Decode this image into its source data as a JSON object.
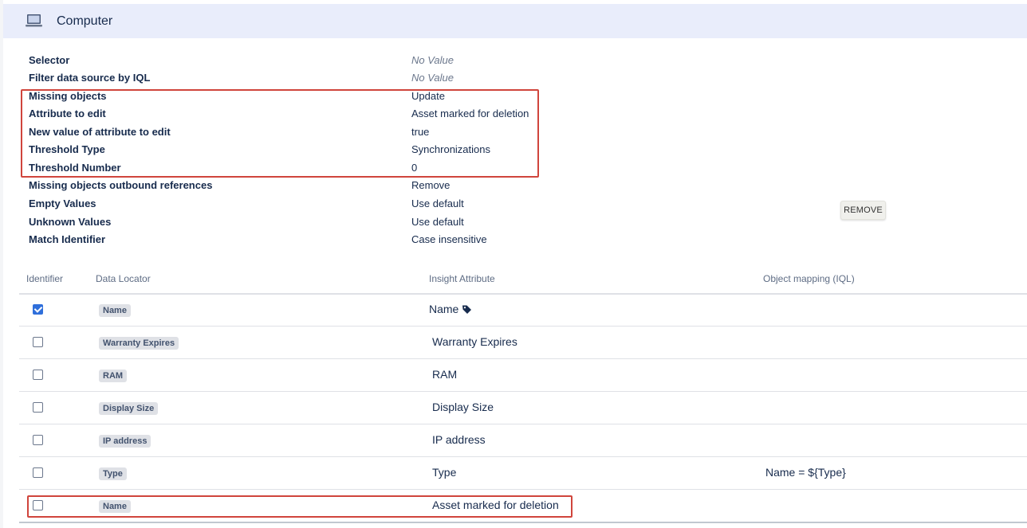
{
  "header": {
    "title": "Computer",
    "icon": "computer-monitor-icon"
  },
  "properties": [
    {
      "label": "Selector",
      "value": "No Value",
      "empty": true
    },
    {
      "label": "Filter data source by IQL",
      "value": "No Value",
      "empty": true
    },
    {
      "label": "Missing objects",
      "value": "Update",
      "empty": false
    },
    {
      "label": "Attribute to edit",
      "value": "Asset marked for deletion",
      "empty": false
    },
    {
      "label": "New value of attribute to edit",
      "value": "true",
      "empty": false
    },
    {
      "label": "Threshold Type",
      "value": "Synchronizations",
      "empty": false
    },
    {
      "label": "Threshold Number",
      "value": "0",
      "empty": false
    },
    {
      "label": "Missing objects outbound references",
      "value": "Remove",
      "empty": false
    },
    {
      "label": "Empty Values",
      "value": "Use default",
      "empty": false
    },
    {
      "label": "Unknown Values",
      "value": "Use default",
      "empty": false
    },
    {
      "label": "Match Identifier",
      "value": "Case insensitive",
      "empty": false
    }
  ],
  "remove_button": {
    "label": "REMOVE"
  },
  "table": {
    "headers": {
      "identifier": "Identifier",
      "data_locator": "Data Locator",
      "insight_attribute": "Insight Attribute",
      "object_mapping": "Object mapping (IQL)"
    },
    "rows": [
      {
        "identifier": true,
        "locator": "Name",
        "attribute": "Name",
        "mapping": "",
        "label_icon": "tag-icon"
      },
      {
        "identifier": false,
        "locator": "Warranty Expires",
        "attribute": "Warranty Expires",
        "mapping": ""
      },
      {
        "identifier": false,
        "locator": "RAM",
        "attribute": "RAM",
        "mapping": ""
      },
      {
        "identifier": false,
        "locator": "Display Size",
        "attribute": "Display Size",
        "mapping": ""
      },
      {
        "identifier": false,
        "locator": "IP address",
        "attribute": "IP address",
        "mapping": ""
      },
      {
        "identifier": false,
        "locator": "Type",
        "attribute": "Type",
        "mapping": "Name = ${Type}"
      },
      {
        "identifier": false,
        "locator": "Name",
        "attribute": "Asset marked for deletion",
        "mapping": ""
      }
    ]
  },
  "colors": {
    "header_bg": "#e9edfb",
    "highlight_border": "#d0453c",
    "checkbox_checked": "#2f6fdb",
    "lozenge_bg": "#dfe1e6"
  }
}
